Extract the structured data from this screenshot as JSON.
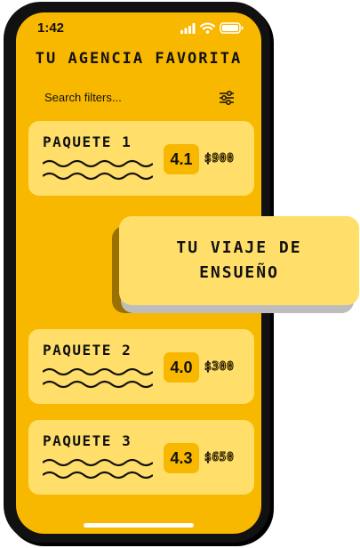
{
  "status_bar": {
    "time": "1:42",
    "icons": [
      "signal-icon",
      "wifi-icon",
      "battery-icon"
    ]
  },
  "header": {
    "title": "TU AGENCIA FAVORITA"
  },
  "search": {
    "placeholder": "Search filters...",
    "value": "",
    "filter_icon": "sliders-icon"
  },
  "packages": [
    {
      "name": "PAQUETE 1",
      "rating": "4.1",
      "price": "$900"
    },
    {
      "name": "PAQUETE 2",
      "rating": "4.0",
      "price": "$300"
    },
    {
      "name": "PAQUETE 3",
      "rating": "4.3",
      "price": "$650"
    }
  ],
  "popup": {
    "line1": "TU VIAJE DE",
    "line2": "ENSUEÑO"
  },
  "colors": {
    "background": "#f8b800",
    "card": "#ffde6a",
    "text": "#111111",
    "phone_frame": "#111111"
  }
}
